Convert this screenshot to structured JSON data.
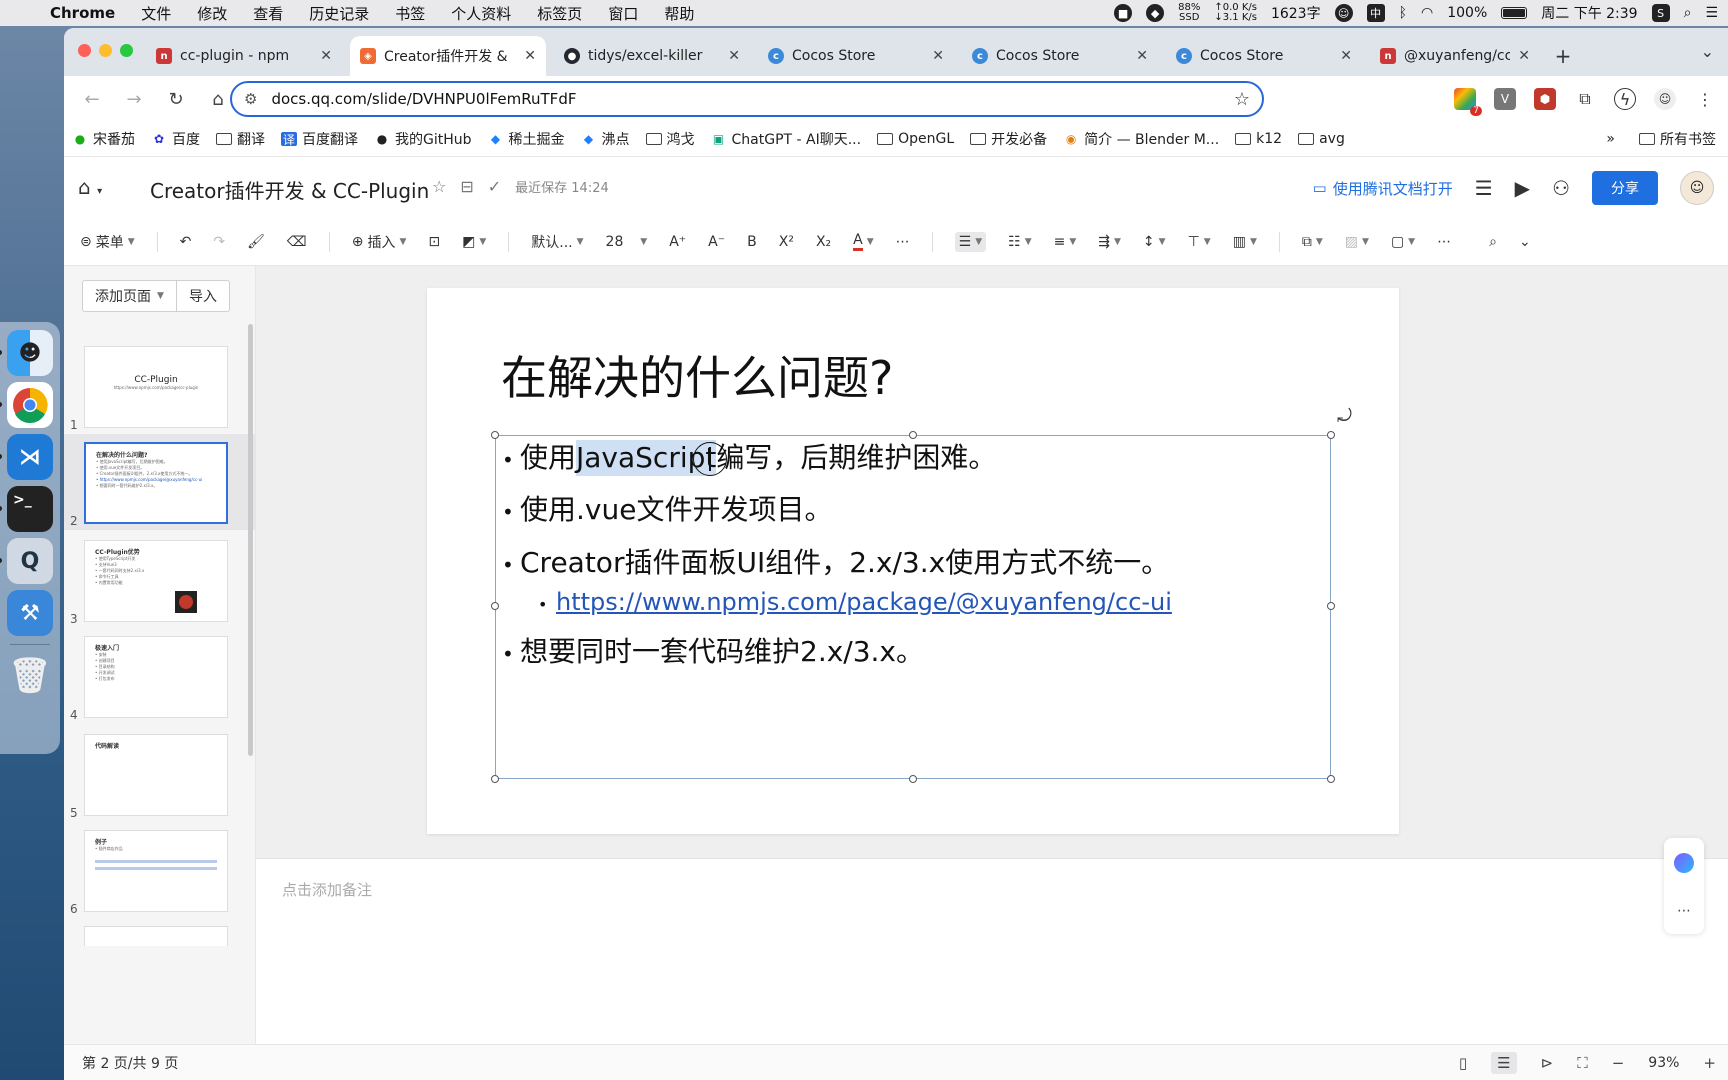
{
  "menubar": {
    "app": "Chrome",
    "items": [
      "文件",
      "修改",
      "查看",
      "历史记录",
      "书签",
      "个人资料",
      "标签页",
      "窗口",
      "帮助"
    ],
    "ssd": "88%",
    "ssd_label": "SSD",
    "net_up": "0.0 K/s",
    "net_down": "3.1 K/s",
    "word_count": "1623字",
    "ime": "中",
    "battery": "100%",
    "datetime": "周二 下午 2:39"
  },
  "tabs": [
    {
      "label": "cc-plugin - npm",
      "favicon_color": "#cb3837"
    },
    {
      "label": "Creator插件开发 &",
      "favicon_color": "#f06a35"
    },
    {
      "label": "tidys/excel-killer",
      "favicon_color": "#24292f"
    },
    {
      "label": "Cocos Store",
      "favicon_color": "#3b8ad9"
    },
    {
      "label": "Cocos Store",
      "favicon_color": "#3b8ad9"
    },
    {
      "label": "Cocos Store",
      "favicon_color": "#3b8ad9"
    },
    {
      "label": "@xuyanfeng/cc-u",
      "favicon_color": "#cb3837"
    }
  ],
  "url": "docs.qq.com/slide/DVHNPU0lFemRuTFdF",
  "ext_badge": "7",
  "bookmarks": [
    {
      "label": "宋番茄",
      "icon": "wechat-icon"
    },
    {
      "label": "百度",
      "icon": "baidu-icon"
    },
    {
      "label": "翻译",
      "icon": "folder-icon"
    },
    {
      "label": "百度翻译",
      "icon": "translate-icon"
    },
    {
      "label": "我的GitHub",
      "icon": "github-icon"
    },
    {
      "label": "稀土掘金",
      "icon": "juejin-icon"
    },
    {
      "label": "沸点",
      "icon": "juejin-icon"
    },
    {
      "label": "鸿戈",
      "icon": "folder-icon"
    },
    {
      "label": "ChatGPT - AI聊天...",
      "icon": "bot-icon"
    },
    {
      "label": "OpenGL",
      "icon": "folder-icon"
    },
    {
      "label": "开发必备",
      "icon": "folder-icon"
    },
    {
      "label": "简介 — Blender M...",
      "icon": "blender-icon"
    },
    {
      "label": "k12",
      "icon": "folder-icon"
    },
    {
      "label": "avg",
      "icon": "folder-icon"
    }
  ],
  "bookmarks_more": "»",
  "all_bookmarks": "所有书签",
  "doc": {
    "title": "Creator插件开发 & CC-Plugin",
    "saved": "最近保存 14:24",
    "open_in_app": "使用腾讯文档打开",
    "share": "分享"
  },
  "format_toolbar": {
    "menu": "菜单",
    "insert": "插入",
    "font": "默认...",
    "font_size": "28"
  },
  "left_panel": {
    "add_page": "添加页面",
    "import": "导入"
  },
  "thumbnails": [
    {
      "num": "1",
      "title": "CC-Plugin",
      "subtitle": "https://www.npmjs.com/package/cc-plugin"
    },
    {
      "num": "2",
      "title": "在解决的什么问题?",
      "lines": [
        "• 使用JavaScript编写，后期维护困难。",
        "• 使用.vue文件开发项目。",
        "• Creator插件面板UI组件，2.x/3.x使用方式不统一。",
        "  • https://www.npmjs.com/package/@xuyanfeng/cc-ui",
        "• 想要同时一套代码维护2.x/3.x。"
      ]
    },
    {
      "num": "3",
      "title": "CC-Plugin优势",
      "lines": [
        "• 使用TypeScript开发",
        "• 支持Vue3",
        "• 一套代码同时支持2.x/3.x",
        "• 命令行工具",
        "• 内置常用功能"
      ]
    },
    {
      "num": "4",
      "title": "极速入门",
      "lines": [
        "• 安装",
        "• 创建项目",
        "• 目录结构",
        "• 开发调试",
        "• 打包发布"
      ]
    },
    {
      "num": "5",
      "title": "代码解读",
      "lines": []
    },
    {
      "num": "6",
      "title": "例子",
      "lines": [
        "• 插件商店作品"
      ]
    }
  ],
  "slide": {
    "title": "在解决的什么问题?",
    "b1_pre": "使用",
    "b1_hl": "JavaScript",
    "b1_post": "编写，后期维护困难。",
    "b2": "使用.vue文件开发项目。",
    "b3": "Creator插件面板UI组件，2.x/3.x使用方式不统一。",
    "b3_link": "https://www.npmjs.com/package/@xuyanfeng/cc-ui",
    "b4": "想要同时一套代码维护2.x/3.x。"
  },
  "notes_placeholder": "点击添加备注",
  "status": {
    "page_info": "第 2 页/共 9 页",
    "zoom": "93%"
  }
}
